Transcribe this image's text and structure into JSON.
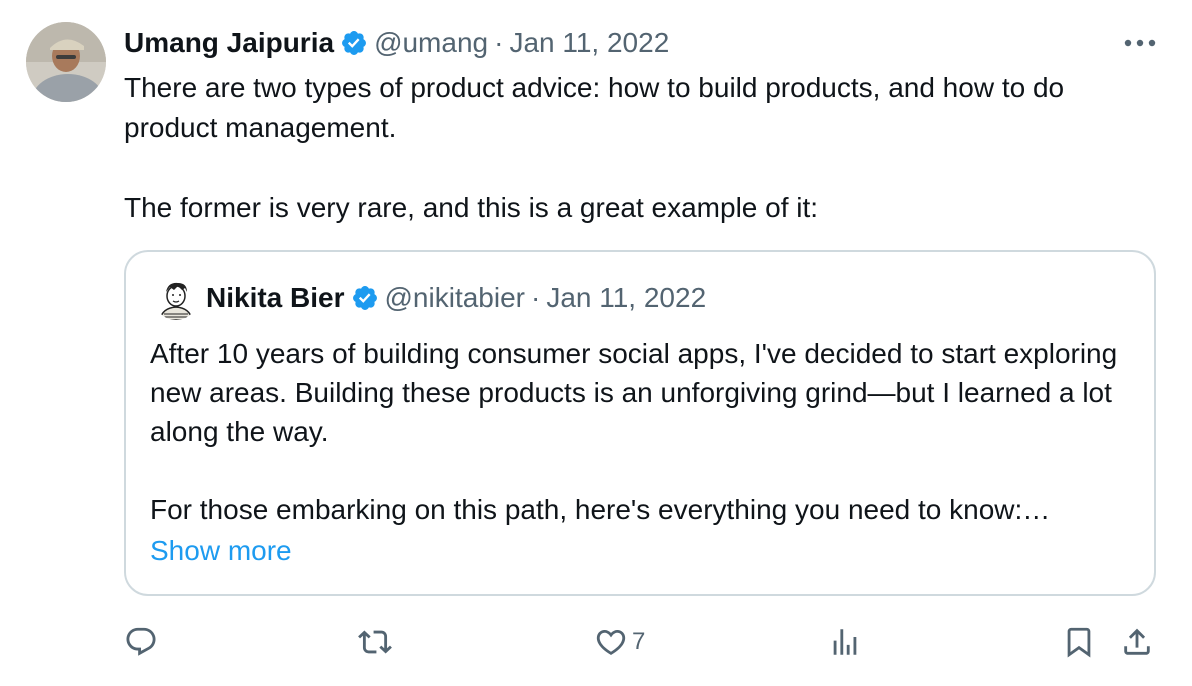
{
  "tweet": {
    "author_name": "Umang Jaipuria",
    "author_handle": "@umang",
    "separator": "·",
    "date": "Jan 11, 2022",
    "text": "There are two types of product advice: how to build products, and how to do product management.\n\nThe former is very rare, and this is a great example of it:"
  },
  "quoted_tweet": {
    "author_name": "Nikita Bier",
    "author_handle": "@nikitabier",
    "separator": "·",
    "date": "Jan 11, 2022",
    "text": "After 10 years of building consumer social apps, I've decided to start exploring new areas. Building these products is an unforgiving grind—but I learned a lot along the way.\n\nFor those embarking on this path, here's everything you need to know:…",
    "show_more_label": "Show more"
  },
  "actions": {
    "reply": {
      "icon": "reply-icon"
    },
    "retweet": {
      "icon": "retweet-icon"
    },
    "like": {
      "icon": "heart-icon",
      "count": "7"
    },
    "views": {
      "icon": "views-icon"
    },
    "bookmark": {
      "icon": "bookmark-icon"
    },
    "share": {
      "icon": "share-icon"
    }
  },
  "colors": {
    "accent": "#1d9bf0",
    "secondary_text": "#536471",
    "border": "#cfd9de"
  }
}
